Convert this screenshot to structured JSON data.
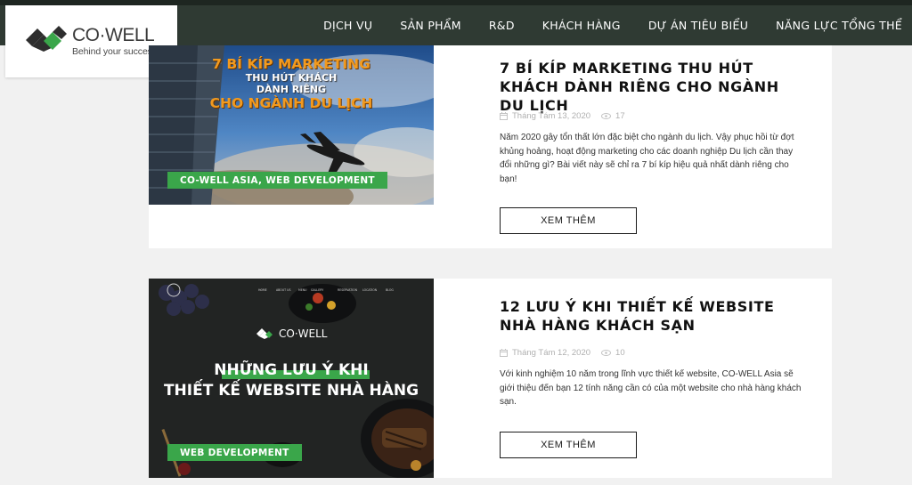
{
  "logo": {
    "name": "CO·WELL",
    "tagline": "Behind your success",
    "icon": "cowell-diamond-logo"
  },
  "nav": {
    "items": [
      "DỊCH VỤ",
      "SẢN PHẨM",
      "R&D",
      "KHÁCH HÀNG",
      "DỰ ÁN TIÊU BIỂU",
      "NĂNG LỰC TỔNG THỂ"
    ]
  },
  "colors": {
    "nav_bg": "#2f3a33",
    "accent_green": "#3aa64a",
    "tag_green": "#3aa64a",
    "title_orange": "#f29a1f"
  },
  "posts": [
    {
      "title": "7 BÍ KÍP MARKETING THU HÚT KHÁCH DÀNH RIÊNG CHO NGÀNH DU LỊCH",
      "date": "Tháng Tám 13, 2020",
      "views": "17",
      "excerpt": "Năm 2020 gây tổn thất lớn đặc biệt cho ngành du lịch. Vậy phục hồi từ đợt khủng hoảng, hoạt động marketing cho các doanh nghiệp Du lịch cần thay đổi những gì? Bài viết này sẽ chỉ ra 7 bí kíp hiệu quả nhất dành riêng cho bạn!",
      "more_label": "XEM THÊM",
      "thumb": {
        "line1": "7 BÍ KÍP MARKETING",
        "line2": "THU HÚT KHÁCH",
        "line3": "DÀNH RIÊNG",
        "line4": "CHO NGÀNH DU LỊCH",
        "tag": "CO-WELL ASIA, WEB DEVELOPMENT"
      }
    },
    {
      "title": "12 LƯU Ý KHI THIẾT KẾ WEBSITE NHÀ HÀNG KHÁCH SẠN",
      "date": "Tháng Tám 12, 2020",
      "views": "10",
      "excerpt": "Với kinh nghiệm 10 năm trong lĩnh vực thiết kế website, CO-WELL Asia sẽ giới thiệu đến bạn 12 tính năng cần có của một website cho nhà hàng khách sạn.",
      "more_label": "XEM THÊM",
      "thumb": {
        "brand": "CO·WELL",
        "line1": "NHỮNG LƯU Ý KHI",
        "line2": "THIẾT KẾ WEBSITE NHÀ HÀNG",
        "tag": "WEB DEVELOPMENT"
      }
    }
  ]
}
